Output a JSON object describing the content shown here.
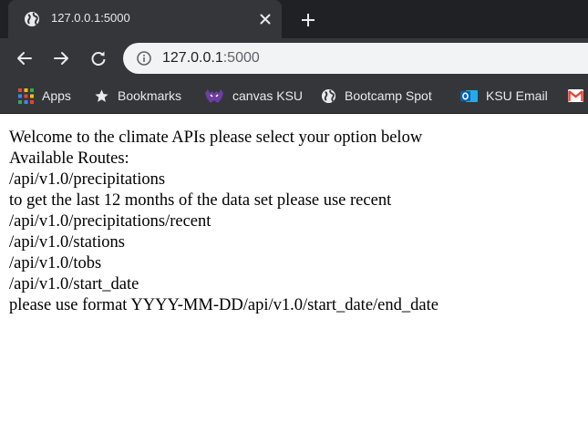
{
  "tab": {
    "title": "127.0.0.1:5000"
  },
  "address_bar": {
    "host": "127.0.0.1",
    "port": ":5000"
  },
  "bookmarks": [
    {
      "label": "Apps",
      "icon": "apps-grid-icon"
    },
    {
      "label": "Bookmarks",
      "icon": "star-icon"
    },
    {
      "label": "canvas KSU",
      "icon": "ksu-wildcat-icon"
    },
    {
      "label": "Bootcamp Spot",
      "icon": "globe-icon"
    },
    {
      "label": "KSU Email",
      "icon": "outlook-icon"
    },
    {
      "label": "",
      "icon": "gmail-icon"
    }
  ],
  "page": {
    "lines": [
      "Welcome to the climate APIs please select your option below",
      "Available Routes:",
      "/api/v1.0/precipitations",
      "to get the last 12 months of the data set please use recent",
      "/api/v1.0/precipitations/recent",
      "/api/v1.0/stations",
      "/api/v1.0/tobs",
      "/api/v1.0/start_date",
      "please use format YYYY-MM-DD/api/v1.0/start_date/end_date"
    ]
  },
  "colors": {
    "chrome_dark": "#202124",
    "chrome_tab": "#35363a",
    "omnibox": "#f1f3f4",
    "text_light": "#e8eaed"
  }
}
